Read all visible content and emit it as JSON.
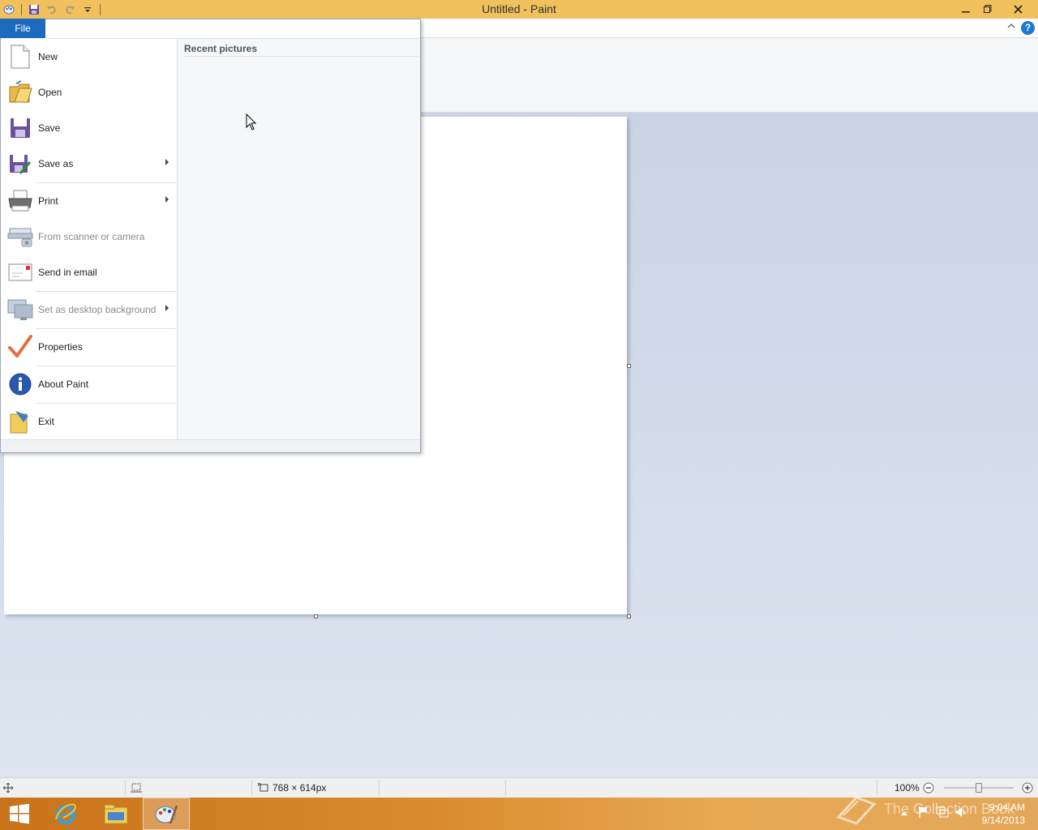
{
  "window": {
    "title": "Untitled - Paint",
    "controls": {
      "minimize": "–",
      "restore": "❐",
      "close": "✕"
    }
  },
  "quick_access": {
    "icons": [
      "paint-app-icon",
      "save-icon",
      "undo-icon",
      "redo-icon",
      "customize-qat-icon"
    ]
  },
  "file_tab": {
    "label": "File"
  },
  "file_menu": {
    "items": [
      {
        "label": "New",
        "icon": "new-file-icon",
        "submenu": false,
        "disabled": false
      },
      {
        "label": "Open",
        "icon": "open-folder-icon",
        "submenu": false,
        "disabled": false
      },
      {
        "label": "Save",
        "icon": "save-disk-icon",
        "submenu": false,
        "disabled": false
      },
      {
        "label": "Save as",
        "icon": "save-as-icon",
        "submenu": true,
        "disabled": false
      },
      {
        "label": "Print",
        "icon": "printer-icon",
        "submenu": true,
        "disabled": false
      },
      {
        "label": "From scanner or camera",
        "icon": "scanner-icon",
        "submenu": false,
        "disabled": true
      },
      {
        "label": "Send in email",
        "icon": "email-icon",
        "submenu": false,
        "disabled": false
      },
      {
        "label": "Set as desktop background",
        "icon": "desktop-background-icon",
        "submenu": true,
        "disabled": true
      },
      {
        "label": "Properties",
        "icon": "checkmark-icon",
        "submenu": false,
        "disabled": false
      },
      {
        "label": "About Paint",
        "icon": "info-icon",
        "submenu": false,
        "disabled": false
      },
      {
        "label": "Exit",
        "icon": "exit-icon",
        "submenu": false,
        "disabled": false
      }
    ],
    "recent_title": "Recent pictures"
  },
  "help": {
    "label": "?"
  },
  "status_bar": {
    "canvas_size": "768 × 614px",
    "zoom": "100%",
    "zoom_slider_fraction": 0.5
  },
  "taskbar": {
    "clock_time": "9:04 AM",
    "clock_date": "9/14/2013",
    "watermark": "The Collection Book"
  },
  "colors": {
    "titlebar": "#f0c15c",
    "file_tab": "#1d6bbf",
    "workspace": "#c9d3e3"
  }
}
